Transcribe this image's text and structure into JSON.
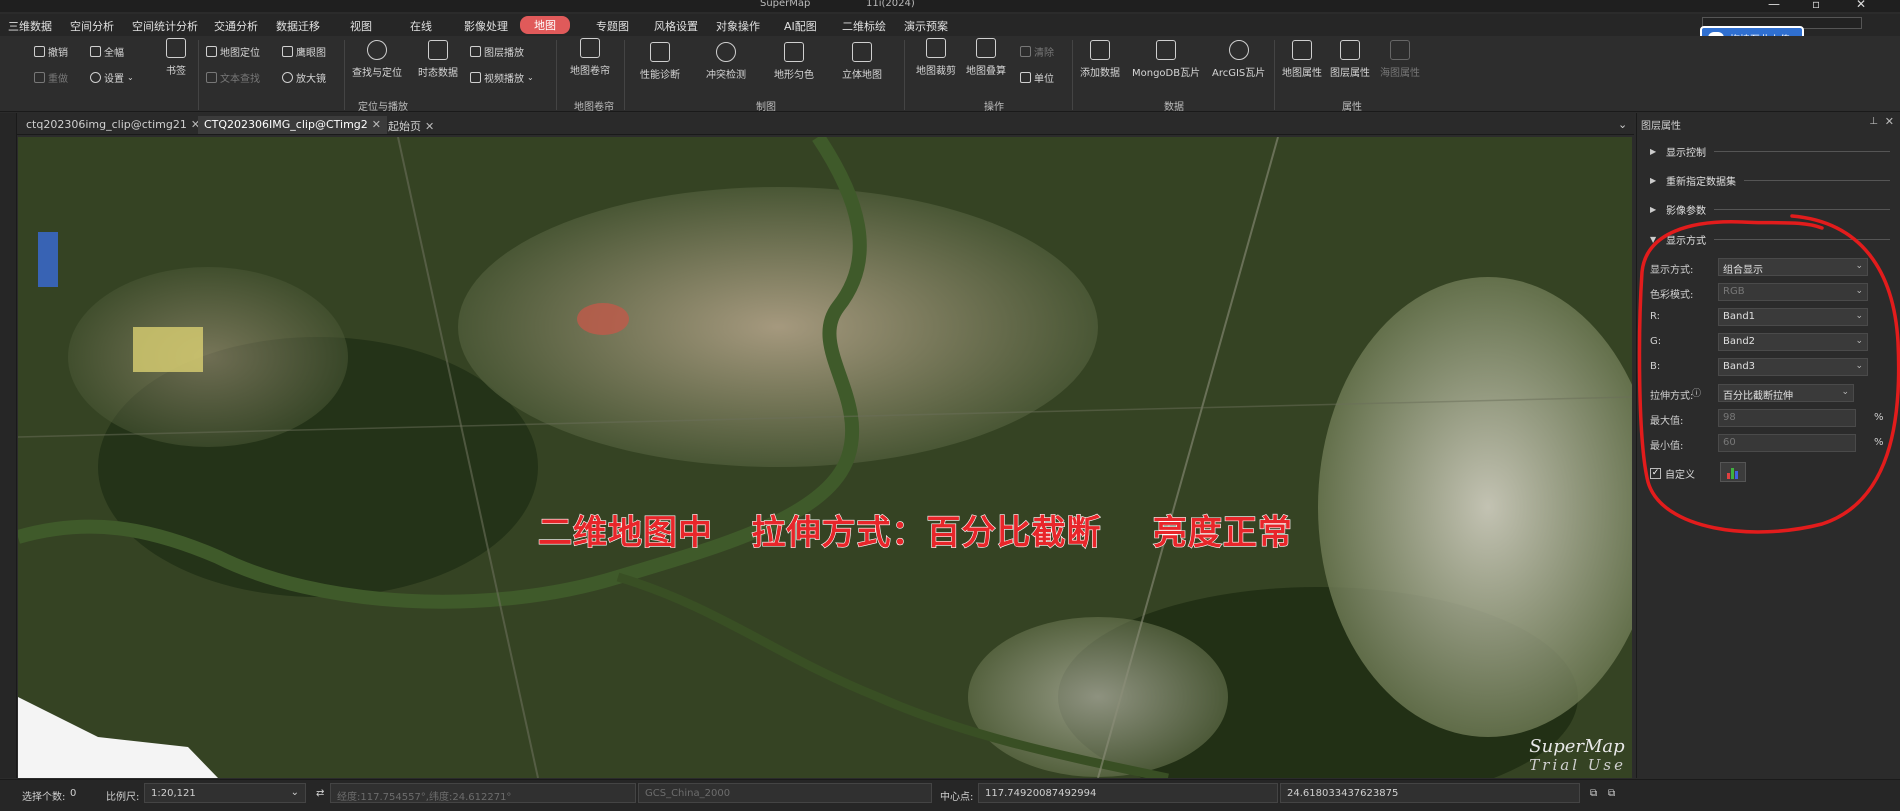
{
  "titlebar": {
    "app": "SuperMap",
    "doc": "11i(2024)"
  },
  "menu": [
    "三维数据",
    "空间分析",
    "空间统计分析",
    "交通分析",
    "数据迁移",
    "视图",
    "在线",
    "影像处理",
    "地图",
    "专题图",
    "风格设置",
    "对象操作",
    "AI配图",
    "二维标绘",
    "演示预案"
  ],
  "menu_active": "地图",
  "ribbon": {
    "small1": [
      "撤销",
      "重做",
      "全幅",
      "设置"
    ],
    "bookmark": "书签",
    "locate": [
      "地图定位",
      "文本查找",
      "鹰眼图",
      "放大镜"
    ],
    "find_locate": "查找与定位",
    "timing": "时态数据",
    "layer_play": "图层播放",
    "video_play": "视频播放",
    "group_play": "定位与播放",
    "roll": "地图卷帘",
    "group_roll": "地图卷帘",
    "draw": [
      "性能诊断",
      "冲突检测",
      "地形匀色",
      "立体地图"
    ],
    "group_draw": "制图",
    "ops": [
      "地图裁剪",
      "地图叠算",
      "清除",
      "单位"
    ],
    "group_ops": "操作",
    "data": [
      "添加数据",
      "MongoDB瓦片",
      "ArcGIS瓦片"
    ],
    "group_data": "数据",
    "props": [
      "地图属性",
      "图层属性",
      "海图属性"
    ],
    "group_props": "属性"
  },
  "upload_label": "拖拽至此上传",
  "tabs": [
    "ctq202306img_clip@ctimg21",
    "CTQ202306IMG_clip@CTimg2",
    "起始页"
  ],
  "map": {
    "overlay": "二维地图中   拉伸方式：百分比截断    亮度正常",
    "watermark_line1": "SuperMap",
    "watermark_line2": "Trial Use"
  },
  "panel": {
    "title": "图层属性",
    "sections": [
      "显示控制",
      "重新指定数据集",
      "影像参数",
      "显示方式"
    ],
    "display_mode": {
      "label": "显示方式:",
      "value": "组合显示"
    },
    "color_mode": {
      "label": "色彩模式:",
      "value": "RGB"
    },
    "r": {
      "label": "R:",
      "value": "Band1"
    },
    "g": {
      "label": "G:",
      "value": "Band2"
    },
    "b": {
      "label": "B:",
      "value": "Band3"
    },
    "stretch": {
      "label": "拉伸方式:",
      "value": "百分比截断拉伸"
    },
    "max": {
      "label": "最大值:",
      "value": "98",
      "unit": "%"
    },
    "min": {
      "label": "最小值:",
      "value": "60",
      "unit": "%"
    },
    "custom": {
      "label": "自定义",
      "checked": "✓"
    }
  },
  "status": {
    "selected_label": "选择个数:",
    "selected_value": "0",
    "scale_label": "比例尺:",
    "scale_value": "1:20,121",
    "coords": "经度:117.754557°,纬度:24.612271°",
    "crs": "GCS_China_2000",
    "center_label": "中心点:",
    "center_x": "117.74920087492994",
    "center_y": "24.618033437623875"
  }
}
